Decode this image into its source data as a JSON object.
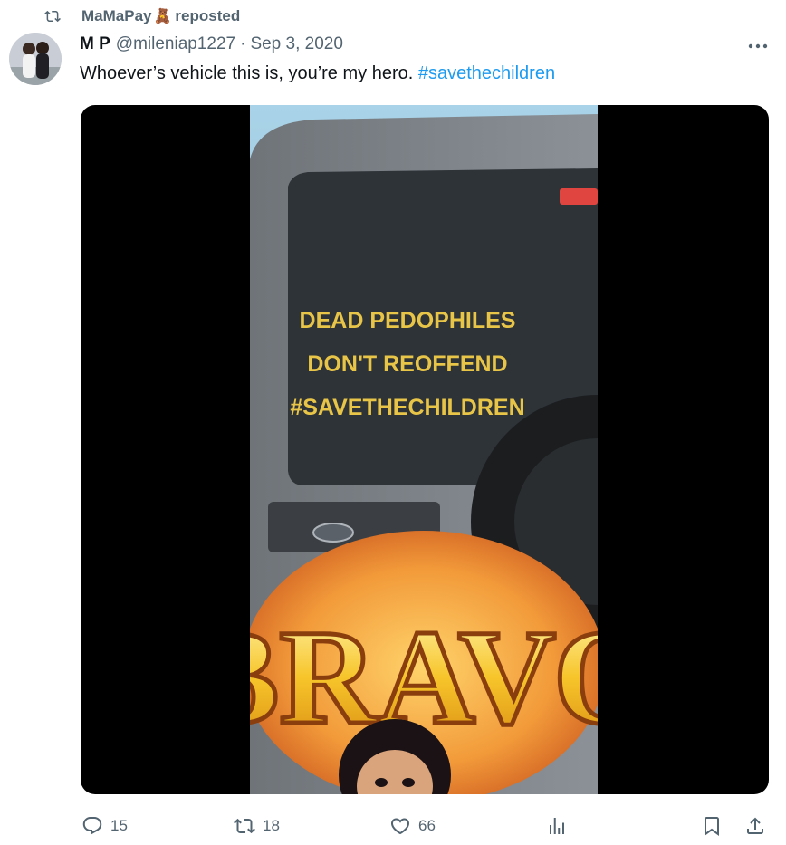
{
  "repost": {
    "user": "MaMaPay",
    "emoji": "🧸",
    "label": "reposted"
  },
  "tweet": {
    "name": "M P",
    "handle": "@mileniap1227",
    "separator": "·",
    "date": "Sep 3, 2020",
    "text_plain": "Whoever’s vehicle this is, you’re my hero. ",
    "hashtag": "#savethechildren"
  },
  "media": {
    "decal_lines": [
      "DEAD PEDOPHILES",
      "DON'T REOFFEND",
      "#SAVETHECHILDREN"
    ],
    "sticker_text": "BRAVO"
  },
  "actions": {
    "replies": "15",
    "reposts": "18",
    "likes": "66"
  },
  "colors": {
    "accent": "#1d9bf0",
    "muted": "#536471"
  }
}
